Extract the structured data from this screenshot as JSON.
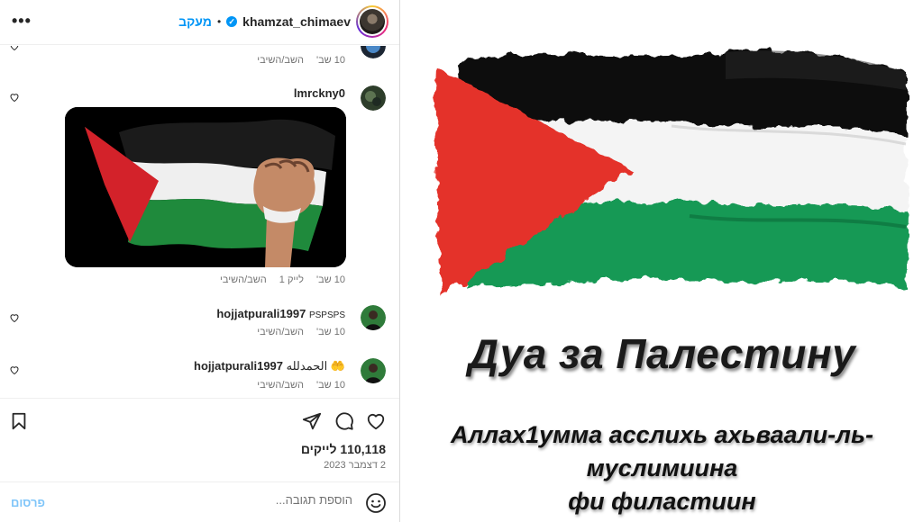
{
  "header": {
    "username": "khamzat_chimaev",
    "verified_badge": "✓",
    "separator": "•",
    "follow_label": "מעקב",
    "more_icon": "•••"
  },
  "comments": [
    {
      "meta": {
        "time": "10 שב'",
        "reply": "השב/השיבי"
      }
    },
    {
      "username": "lmrckny0",
      "meta": {
        "time": "10 שב'",
        "likes": "לייק 1",
        "reply": "השב/השיבי"
      }
    },
    {
      "username": "hojjatpurali1997",
      "text": "PSPSPS",
      "meta": {
        "time": "10 שב'",
        "reply": "השב/השיבי"
      }
    },
    {
      "username": "hojjatpurali1997",
      "text": "الحمدلله 🤲",
      "meta": {
        "time": "10 שב'",
        "reply": "השב/השיבי"
      }
    }
  ],
  "actions": {
    "likes": "110,118 לייקים",
    "date": "2 דצמבר 2023"
  },
  "add_comment": {
    "placeholder": "הוספת תגובה...",
    "post_label": "פרסום"
  },
  "post_image": {
    "title": "Дуа за Палестину",
    "dua_lines": [
      "Аллах1умма асслихь ахьваали-ль-",
      "муслимиина",
      "фи филастиин"
    ]
  },
  "colors": {
    "link_blue": "#0095f6",
    "flag_red": "#e4312b",
    "flag_green": "#149954",
    "flag_black": "#000000"
  }
}
